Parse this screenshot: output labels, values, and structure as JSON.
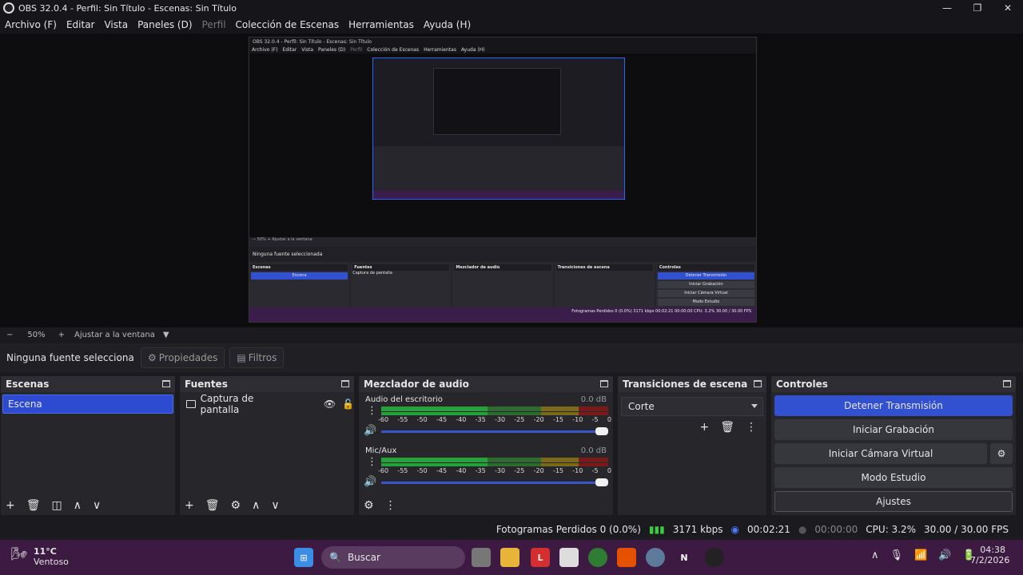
{
  "window": {
    "title": "OBS 32.0.4 - Perfil: Sin Título - Escenas: Sin Título",
    "controls": [
      "—",
      "❐",
      "✕"
    ]
  },
  "menu": [
    {
      "label": "Archivo (F)",
      "enabled": true
    },
    {
      "label": "Editar",
      "enabled": true
    },
    {
      "label": "Vista",
      "enabled": true
    },
    {
      "label": "Paneles (D)",
      "enabled": true
    },
    {
      "label": "Perfil",
      "enabled": false
    },
    {
      "label": "Colección de Escenas",
      "enabled": true
    },
    {
      "label": "Herramientas",
      "enabled": true
    },
    {
      "label": "Ayuda (H)",
      "enabled": true
    }
  ],
  "zoom": {
    "minus": "−",
    "value": "50%",
    "plus": "+",
    "fit": "Ajustar a la ventana"
  },
  "selection": {
    "label": "Ninguna fuente selecciona",
    "properties": "Propiedades",
    "filters": "Filtros"
  },
  "scenes": {
    "title": "Escenas",
    "items": [
      "Escena"
    ]
  },
  "sources": {
    "title": "Fuentes",
    "items": [
      "Captura de pantalla"
    ]
  },
  "mixer": {
    "title": "Mezclador de audio",
    "channels": [
      {
        "name": "Audio del escritorio",
        "db": "0.0 dB",
        "level": 0.2
      },
      {
        "name": "Mic/Aux",
        "db": "0.0 dB",
        "level": 0.17
      }
    ],
    "scale": [
      "-60",
      "-55",
      "-50",
      "-45",
      "-40",
      "-35",
      "-30",
      "-25",
      "-20",
      "-15",
      "-10",
      "-5",
      "0"
    ]
  },
  "transitions": {
    "title": "Transiciones de escena",
    "selected": "Corte"
  },
  "controls": {
    "title": "Controles",
    "stop_stream": "Detener Transmisión",
    "start_record": "Iniciar Grabación",
    "start_vcam": "Iniciar Cámara Virtual",
    "studio": "Modo Estudio",
    "settings": "Ajustes"
  },
  "status": {
    "dropped": "Fotogramas Perdidos 0 (0.0%)",
    "bitrate": "3171 kbps",
    "stream_time": "00:02:21",
    "record_time": "00:00:00",
    "cpu": "CPU: 3.2%",
    "fps": "30.00 / 30.00 FPS"
  },
  "nested": {
    "title": "OBS 32.0.4 - Perfil: Sin Título - Escenas: Sin Título",
    "menu": [
      "Archivo (F)",
      "Editar",
      "Vista",
      "Paneles (D)",
      "Perfil",
      "Colección de Escenas",
      "Herramientas",
      "Ayuda (H)"
    ],
    "zoom": "−   50%   +   Ajustar a la ventana",
    "selection": "Ninguna fuente seleccionada",
    "docks": [
      "Escenas",
      "Fuentes",
      "Mezclador de audio",
      "Transiciones de escena",
      "Controles"
    ],
    "scene": "Escena",
    "source": "Captura de pantalla",
    "status": "Fotogramas Perdidos 0 (0.0%)   3171 kbps   00:02:21   00:00:00   CPU: 3.2%   30.00 / 30.00 FPS"
  },
  "taskbar": {
    "weather_temp": "11°C",
    "weather_desc": "Ventoso",
    "search": "Buscar",
    "time": "04:38",
    "date": "7/2/2026"
  }
}
